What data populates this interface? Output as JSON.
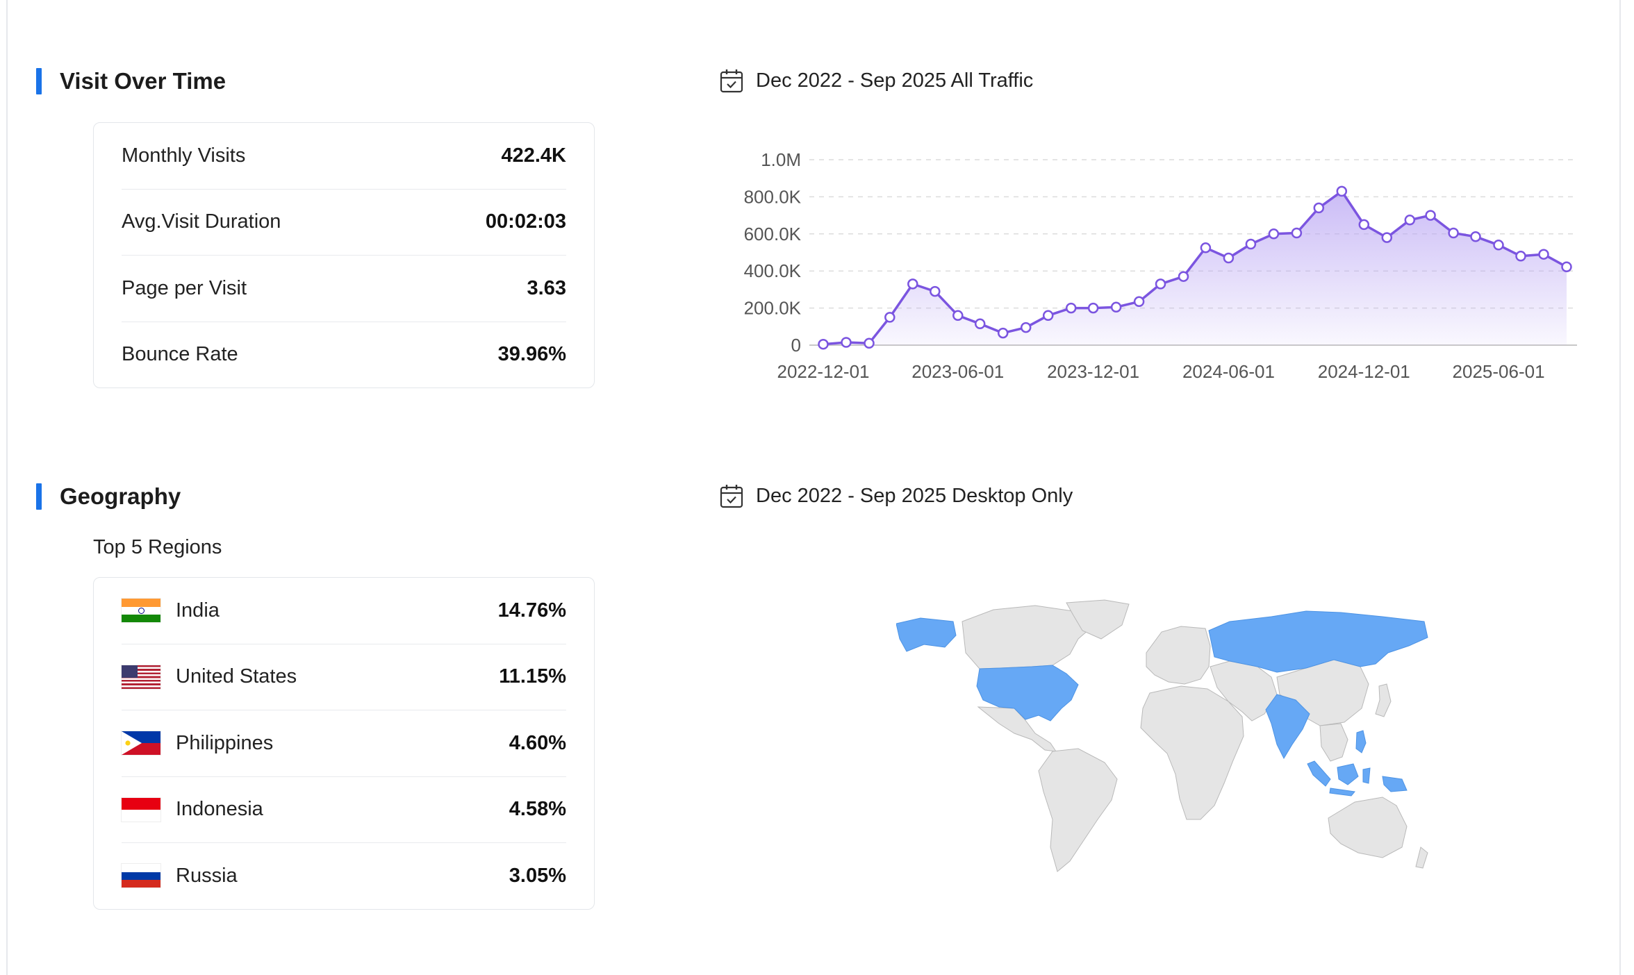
{
  "visit_section": {
    "title": "Visit Over Time",
    "stats": [
      {
        "label": "Monthly Visits",
        "value": "422.4K"
      },
      {
        "label": "Avg.Visit Duration",
        "value": "00:02:03"
      },
      {
        "label": "Page per Visit",
        "value": "3.63"
      },
      {
        "label": "Bounce Rate",
        "value": "39.96%"
      }
    ]
  },
  "traffic_date_label": "Dec 2022 - Sep 2025 All Traffic",
  "geo_section": {
    "title": "Geography",
    "subtitle": "Top 5 Regions",
    "regions": [
      {
        "country": "India",
        "share": "14.76%"
      },
      {
        "country": "United States",
        "share": "11.15%"
      },
      {
        "country": "Philippines",
        "share": "4.60%"
      },
      {
        "country": "Indonesia",
        "share": "4.58%"
      },
      {
        "country": "Russia",
        "share": "3.05%"
      }
    ]
  },
  "geo_date_label": "Dec 2022 - Sep 2025 Desktop Only",
  "colors": {
    "accent_bar": "#1a73e8",
    "line": "#7b55e0",
    "area": "#b9a5f3",
    "map_highlight": "#66a8f5",
    "map_land": "#e5e5e5"
  },
  "chart_data": {
    "type": "area",
    "x_tick_labels": [
      "2022-12-01",
      "2023-06-01",
      "2023-12-01",
      "2024-06-01",
      "2024-12-01",
      "2025-06-01"
    ],
    "y_tick_labels": [
      "0",
      "200.0K",
      "400.0K",
      "600.0K",
      "800.0K",
      "1.0M"
    ],
    "ylim": [
      0,
      1000000
    ],
    "grid": true,
    "series": [
      {
        "values": [
          {
            "x": "2022-12-01",
            "y": 5000
          },
          {
            "x": "2023-01-01",
            "y": 15000
          },
          {
            "x": "2023-02-01",
            "y": 10000
          },
          {
            "x": "2023-03-01",
            "y": 150000
          },
          {
            "x": "2023-04-01",
            "y": 330000
          },
          {
            "x": "2023-05-01",
            "y": 290000
          },
          {
            "x": "2023-06-01",
            "y": 160000
          },
          {
            "x": "2023-07-01",
            "y": 115000
          },
          {
            "x": "2023-08-01",
            "y": 65000
          },
          {
            "x": "2023-09-01",
            "y": 95000
          },
          {
            "x": "2023-10-01",
            "y": 160000
          },
          {
            "x": "2023-11-01",
            "y": 200000
          },
          {
            "x": "2023-12-01",
            "y": 200000
          },
          {
            "x": "2024-01-01",
            "y": 205000
          },
          {
            "x": "2024-02-01",
            "y": 235000
          },
          {
            "x": "2024-03-01",
            "y": 330000
          },
          {
            "x": "2024-04-01",
            "y": 370000
          },
          {
            "x": "2024-05-01",
            "y": 525000
          },
          {
            "x": "2024-06-01",
            "y": 470000
          },
          {
            "x": "2024-07-01",
            "y": 545000
          },
          {
            "x": "2024-08-01",
            "y": 600000
          },
          {
            "x": "2024-09-01",
            "y": 605000
          },
          {
            "x": "2024-10-01",
            "y": 740000
          },
          {
            "x": "2024-11-01",
            "y": 830000
          },
          {
            "x": "2024-12-01",
            "y": 650000
          },
          {
            "x": "2025-01-01",
            "y": 580000
          },
          {
            "x": "2025-02-01",
            "y": 675000
          },
          {
            "x": "2025-03-01",
            "y": 700000
          },
          {
            "x": "2025-04-01",
            "y": 605000
          },
          {
            "x": "2025-05-01",
            "y": 585000
          },
          {
            "x": "2025-06-01",
            "y": 540000
          },
          {
            "x": "2025-07-01",
            "y": 480000
          },
          {
            "x": "2025-08-01",
            "y": 490000
          },
          {
            "x": "2025-09-01",
            "y": 422000
          }
        ]
      }
    ]
  },
  "map_highlighted_countries": [
    "United States",
    "Russia",
    "India",
    "Indonesia",
    "Philippines"
  ]
}
